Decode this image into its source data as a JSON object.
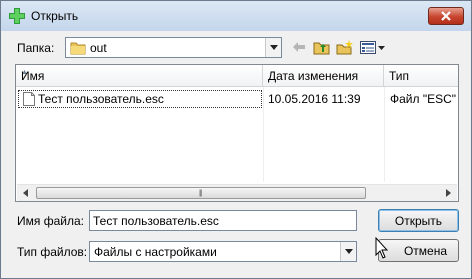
{
  "window": {
    "title": "Открыть",
    "icon": "open-file-plus-icon"
  },
  "lookin": {
    "label": "Папка:",
    "value": "out",
    "folder_icon": "folder-icon"
  },
  "toolbar": {
    "icons": [
      "back-arrow-icon",
      "up-folder-icon",
      "new-folder-icon",
      "view-menu-icon"
    ]
  },
  "file_list": {
    "columns": [
      "Имя",
      "Дата изменения",
      "Тип"
    ],
    "rows": [
      {
        "name": "Тест пользователь.esc",
        "date": "10.05.2016 11:39",
        "type": "Файл \"ESC\""
      }
    ]
  },
  "filename": {
    "label": "Имя файла:",
    "value": "Тест пользователь.esc"
  },
  "filetype": {
    "label": "Тип файлов:",
    "value": "Файлы с настройками"
  },
  "buttons": {
    "open": "Открыть",
    "cancel": "Отмена"
  },
  "colors": {
    "titlebar": "#c4d6ec",
    "close": "#c7452e",
    "dialog": "#f0f0f0"
  }
}
